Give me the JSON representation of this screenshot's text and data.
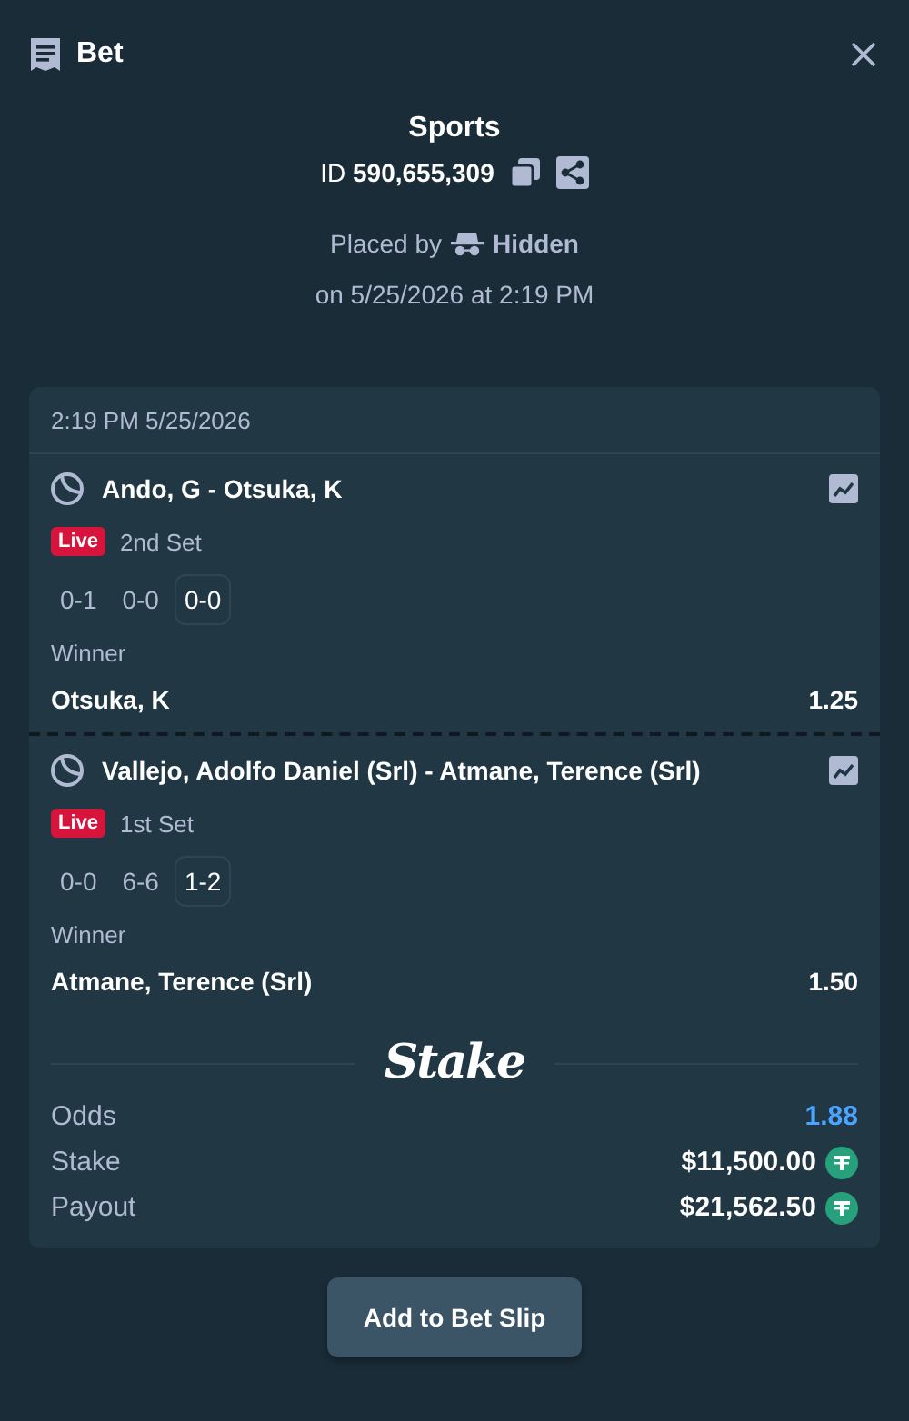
{
  "header": {
    "title": "Bet"
  },
  "summary": {
    "title": "Sports",
    "id_label": "ID",
    "id_value": "590,655,309",
    "placed_by": "Placed by",
    "user": "Hidden",
    "placed_on": "on 5/25/2026 at 2:19 PM"
  },
  "card": {
    "timestamp": "2:19 PM 5/25/2026",
    "legs": [
      {
        "match": "Ando, G - Otsuka, K",
        "live": "Live",
        "period": "2nd Set",
        "scores": [
          {
            "text": "0-1",
            "current": false
          },
          {
            "text": "0-0",
            "current": false
          },
          {
            "text": "0-0",
            "current": true
          }
        ],
        "market": "Winner",
        "selection": "Otsuka, K",
        "odds": "1.25"
      },
      {
        "match": "Vallejo, Adolfo Daniel (Srl) - Atmane, Terence (Srl)",
        "live": "Live",
        "period": "1st Set",
        "scores": [
          {
            "text": "0-0",
            "current": false
          },
          {
            "text": "6-6",
            "current": false
          },
          {
            "text": "1-2",
            "current": true
          }
        ],
        "market": "Winner",
        "selection": "Atmane, Terence (Srl)",
        "odds": "1.50"
      }
    ],
    "brand": "Stake",
    "totals": [
      {
        "kind": "odds",
        "label": "Odds",
        "value": "1.88"
      },
      {
        "kind": "amount",
        "label": "Stake",
        "value": "$11,500.00"
      },
      {
        "kind": "amount",
        "label": "Payout",
        "value": "$21,562.50"
      }
    ]
  },
  "button": "Add to Bet Slip"
}
